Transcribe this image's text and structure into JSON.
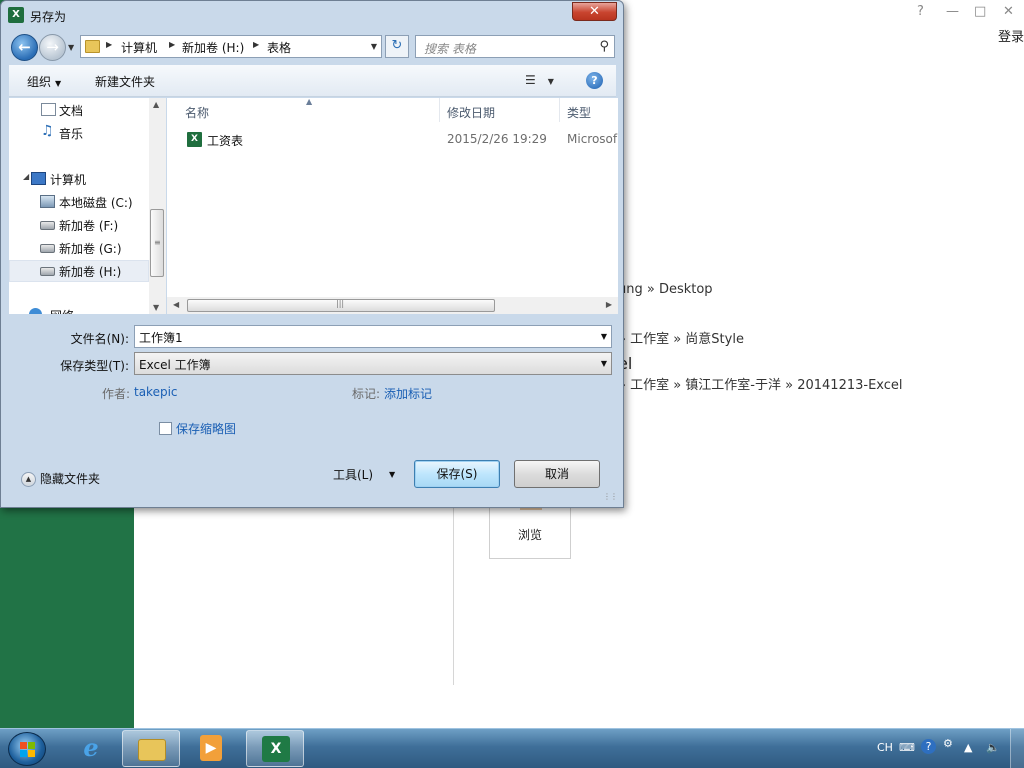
{
  "background": {
    "window_controls": [
      "?",
      "—",
      "□",
      "✕"
    ],
    "login": "登录",
    "recent_paths": [
      "ung » Desktop",
      "» 工作室 » 尚意Style",
      "el",
      "» 工作室 » 镇江工作室-于洋 » 20141213-Excel"
    ],
    "browse_label": "浏览",
    "colors": {
      "sidebar": "#217346"
    }
  },
  "dialog": {
    "title": "另存为",
    "title_icon": "excel-icon",
    "close_label": "✕",
    "address": {
      "segments": [
        "计算机",
        "新加卷 (H:)",
        "表格"
      ]
    },
    "search_placeholder": "搜索 表格",
    "toolbar": {
      "organize": "组织",
      "new_folder": "新建文件夹",
      "help": "?"
    },
    "nav_items": [
      {
        "label": "文档",
        "icon": "document-icon"
      },
      {
        "label": "音乐",
        "icon": "music-icon"
      },
      {
        "label": "计算机",
        "icon": "computer-icon"
      },
      {
        "label": "本地磁盘 (C:)",
        "icon": "local-disk-icon"
      },
      {
        "label": "新加卷 (F:)",
        "icon": "drive-icon"
      },
      {
        "label": "新加卷 (G:)",
        "icon": "drive-icon"
      },
      {
        "label": "新加卷 (H:)",
        "icon": "drive-icon",
        "selected": true
      },
      {
        "label": "网络",
        "icon": "network-icon"
      }
    ],
    "columns": [
      "名称",
      "修改日期",
      "类型"
    ],
    "files": [
      {
        "name": "工资表",
        "modified": "2015/2/26 19:29",
        "type": "Microsof"
      }
    ],
    "form": {
      "filename_label": "文件名(N):",
      "filename_value": "工作簿1",
      "filetype_label": "保存类型(T):",
      "filetype_value": "Excel 工作簿",
      "author_label": "作者:",
      "author_value": "takepic",
      "tags_label": "标记:",
      "tags_value": "添加标记",
      "thumbnail_label": "保存缩略图"
    },
    "footer": {
      "hide_folders": "隐藏文件夹",
      "tools": "工具(L)",
      "save": "保存(S)",
      "cancel": "取消"
    }
  },
  "taskbar": {
    "apps": [
      {
        "name": "internet-explorer",
        "glyph": "e",
        "active": false
      },
      {
        "name": "file-explorer",
        "glyph": "",
        "active": false
      },
      {
        "name": "media-player",
        "glyph": "▶",
        "active": false
      },
      {
        "name": "excel",
        "glyph": "X",
        "active": true
      }
    ],
    "tray": {
      "language": "CH",
      "help": "?"
    },
    "colors": {
      "accent": "#2f5a80"
    }
  }
}
